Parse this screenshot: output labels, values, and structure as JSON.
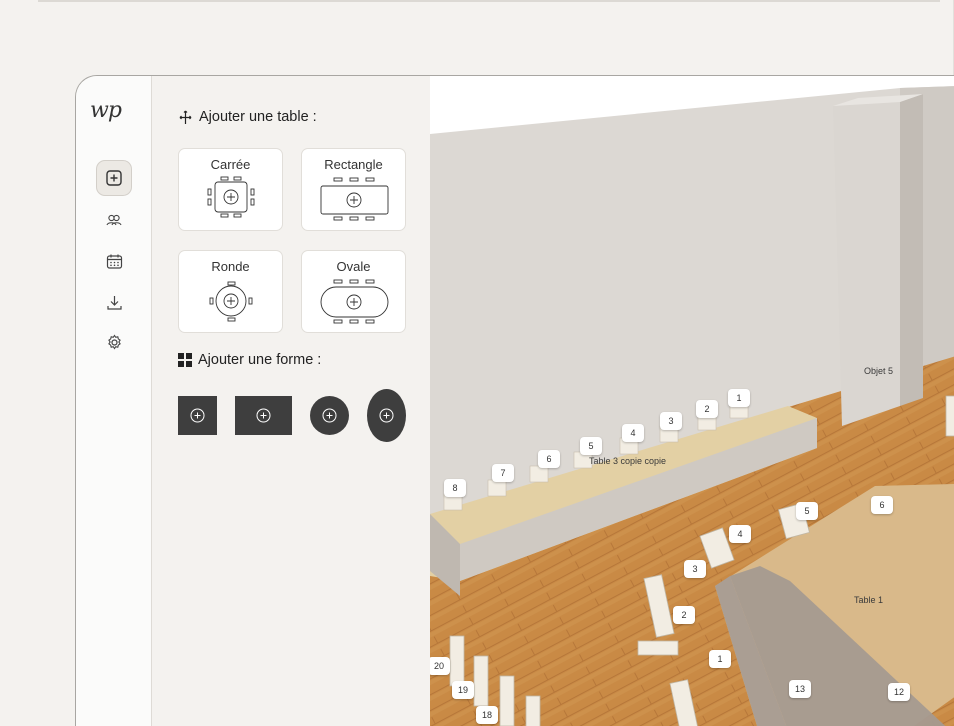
{
  "app": {
    "logo_text": "wp"
  },
  "rail": {
    "items": [
      {
        "name": "add-table",
        "icon": "plus-square-icon"
      },
      {
        "name": "guests",
        "icon": "users-icon"
      },
      {
        "name": "calendar",
        "icon": "calendar-icon"
      },
      {
        "name": "download",
        "icon": "download-icon"
      },
      {
        "name": "settings",
        "icon": "gear-icon"
      }
    ]
  },
  "panel": {
    "add_table_title": "Ajouter une table :",
    "tables": [
      {
        "label": "Carrée"
      },
      {
        "label": "Rectangle"
      },
      {
        "label": "Ronde"
      },
      {
        "label": "Ovale"
      }
    ],
    "add_shape_title": "Ajouter une forme :"
  },
  "scene": {
    "object_label": "Objet 5",
    "table3_label": "Table 3 copie copie",
    "table1_label": "Table 1",
    "table3_seats": [
      "1",
      "2",
      "3",
      "4",
      "5",
      "6",
      "7",
      "8"
    ],
    "table1_seats": [
      "1",
      "2",
      "3",
      "4",
      "5",
      "6",
      "12",
      "13",
      "18",
      "19",
      "20"
    ]
  },
  "colors": {
    "accent_dark": "#3e3e3e",
    "floor": "#c98a45",
    "wall": "#dcd8d3"
  }
}
